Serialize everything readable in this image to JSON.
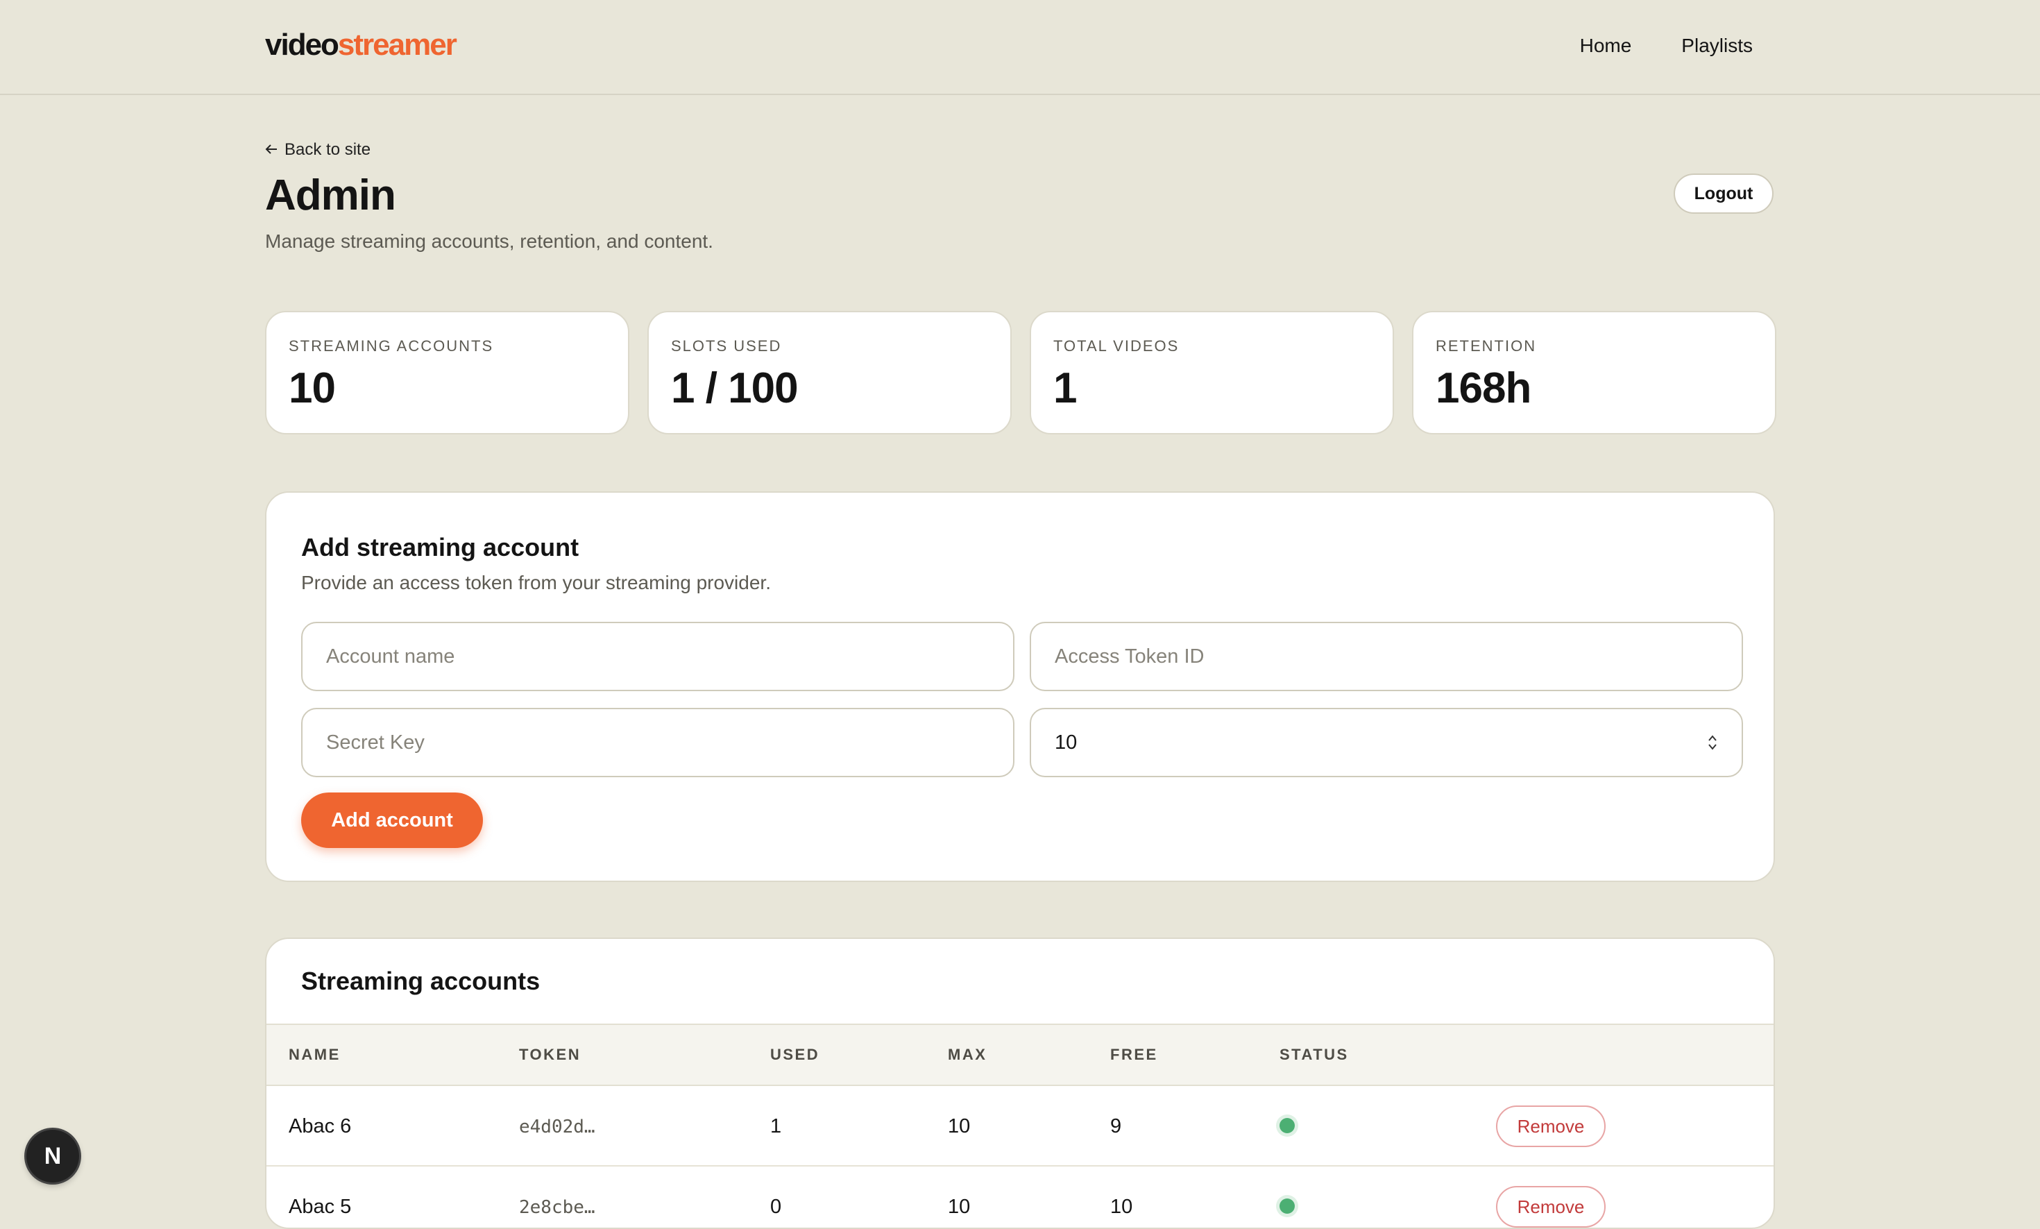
{
  "header": {
    "logo_part1": "video",
    "logo_part2": "streamer",
    "nav": [
      {
        "label": "Home"
      },
      {
        "label": "Playlists"
      }
    ]
  },
  "page": {
    "back_label": "Back to site",
    "title": "Admin",
    "subtitle": "Manage streaming accounts, retention, and content.",
    "logout_label": "Logout"
  },
  "stats": [
    {
      "label": "STREAMING ACCOUNTS",
      "value": "10"
    },
    {
      "label": "SLOTS USED",
      "value": "1 / 100"
    },
    {
      "label": "TOTAL VIDEOS",
      "value": "1"
    },
    {
      "label": "RETENTION",
      "value": "168h"
    }
  ],
  "add_account": {
    "title": "Add streaming account",
    "description": "Provide an access token from your streaming provider.",
    "account_name_placeholder": "Account name",
    "token_id_placeholder": "Access Token ID",
    "secret_key_placeholder": "Secret Key",
    "max_slots_value": "10",
    "submit_label": "Add account"
  },
  "accounts": {
    "title": "Streaming accounts",
    "columns": [
      "NAME",
      "TOKEN",
      "USED",
      "MAX",
      "FREE",
      "STATUS"
    ],
    "rows": [
      {
        "name": "Abac 6",
        "token": "e4d02d…",
        "used": "1",
        "max": "10",
        "free": "9",
        "status": "active",
        "action": "Remove"
      },
      {
        "name": "Abac 5",
        "token": "2e8cbe…",
        "used": "0",
        "max": "10",
        "free": "10",
        "status": "active",
        "action": "Remove"
      }
    ],
    "status_color": "#4caf73"
  },
  "dev_badge": "N",
  "colors": {
    "accent": "#ef6530",
    "background": "#e8e6d9",
    "danger": "#c23a3a"
  }
}
